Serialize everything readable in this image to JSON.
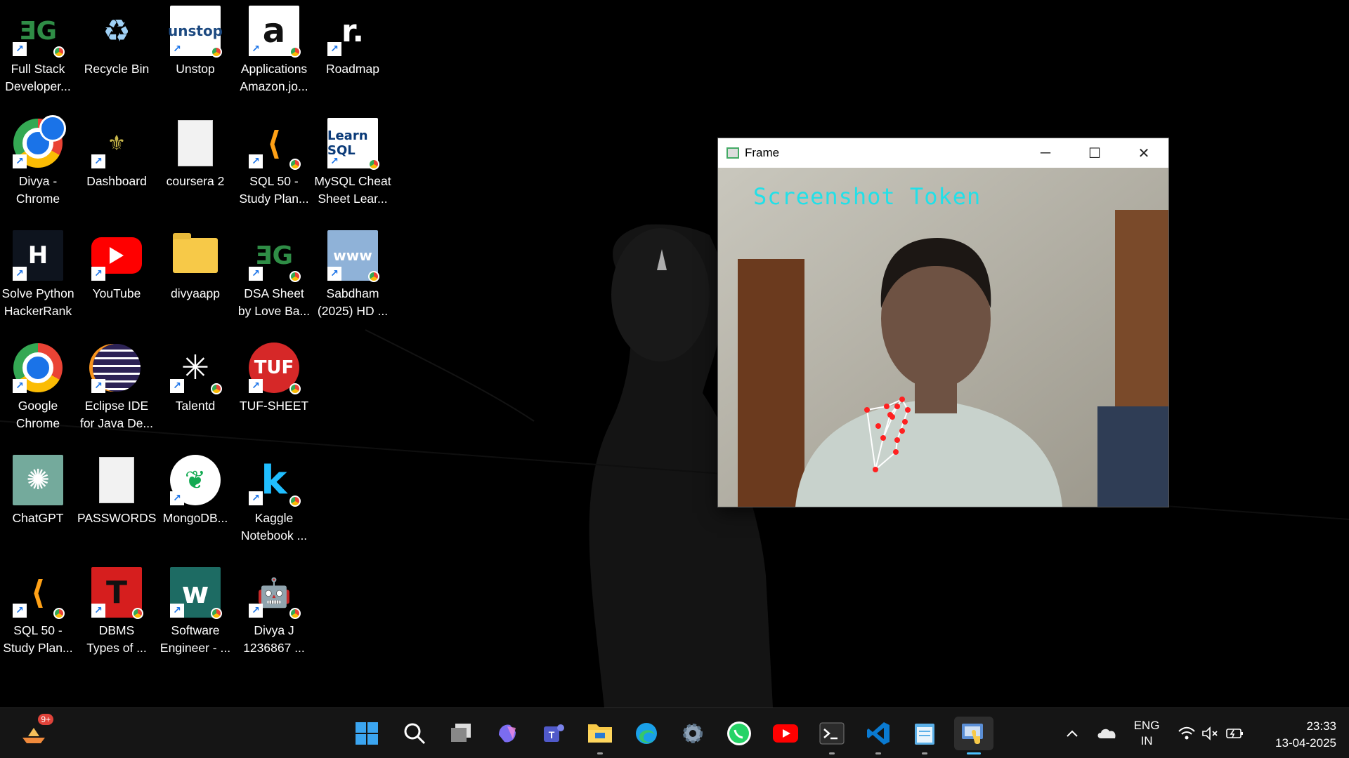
{
  "desktop": {
    "icons": [
      {
        "label": "Full Stack\nDeveloper...",
        "icon": "geeksforgeeks-icon"
      },
      {
        "label": "Recycle Bin",
        "icon": "recycle-bin-icon"
      },
      {
        "label": "Unstop",
        "icon": "unstop-icon",
        "text": "unstop"
      },
      {
        "label": "Applications\nAmazon.jo...",
        "icon": "amazon-icon",
        "text": "a"
      },
      {
        "label": "Roadmap",
        "icon": "roadmap-icon",
        "text": "r."
      },
      {
        "label": "Divya -\nChrome",
        "icon": "chrome-profile-icon"
      },
      {
        "label": "Dashboard",
        "icon": "dashboard-icon"
      },
      {
        "label": "coursera 2",
        "icon": "file-icon"
      },
      {
        "label": "SQL 50 -\nStudy Plan...",
        "icon": "leetcode-icon"
      },
      {
        "label": "MySQL Cheat\nSheet   Lear...",
        "icon": "learn-sql-icon",
        "text": "Learn SQL"
      },
      {
        "label": "Solve Python\nHackerRank",
        "icon": "hackerrank-icon",
        "text": "H"
      },
      {
        "label": "YouTube",
        "icon": "youtube-icon"
      },
      {
        "label": "divyaapp",
        "icon": "folder-icon"
      },
      {
        "label": "DSA Sheet\nby Love Ba...",
        "icon": "geeksforgeeks-icon"
      },
      {
        "label": "Sabdham\n(2025) HD ...",
        "icon": "www-icon",
        "text": "www"
      },
      {
        "label": "Google\nChrome",
        "icon": "chrome-icon"
      },
      {
        "label": "Eclipse IDE\nfor Java De...",
        "icon": "eclipse-icon"
      },
      {
        "label": "Talentd",
        "icon": "talentd-icon"
      },
      {
        "label": "TUF-SHEET",
        "icon": "tuf-icon",
        "text": "TUF"
      },
      {
        "label": "ChatGPT",
        "icon": "chatgpt-icon"
      },
      {
        "label": "PASSWORDS",
        "icon": "file-icon"
      },
      {
        "label": "MongoDB...",
        "icon": "mongodb-icon"
      },
      {
        "label": "Kaggle\nNotebook ...",
        "icon": "kaggle-icon",
        "text": "k"
      },
      {
        "label": "SQL 50 -\nStudy Plan...",
        "icon": "leetcode-icon"
      },
      {
        "label": "DBMS\nTypes of ...",
        "icon": "dbms-icon",
        "text": "T"
      },
      {
        "label": "Software\nEngineer - ...",
        "icon": "software-engineer-icon",
        "text": "w"
      },
      {
        "label": "Divya J\n1236867   ...",
        "icon": "robot-icon"
      }
    ]
  },
  "window": {
    "title": "Frame",
    "overlay_text": "Screenshot Token"
  },
  "taskbar": {
    "weather_badge": "9+",
    "apps": [
      "start-icon",
      "search-icon",
      "task-view-icon",
      "copilot-icon",
      "teams-icon",
      "file-explorer-icon",
      "edge-icon",
      "settings-icon",
      "whatsapp-icon",
      "youtube-icon",
      "terminal-icon",
      "vscode-icon",
      "notepad-icon",
      "python-icon"
    ],
    "tray": {
      "lang_top": "ENG",
      "lang_bottom": "IN",
      "time": "23:33",
      "date": "13-04-2025"
    }
  },
  "colors": {
    "overlay_text": "#22e0e8",
    "accent": "#4cc2ff",
    "landmarks": "#ff2020"
  }
}
